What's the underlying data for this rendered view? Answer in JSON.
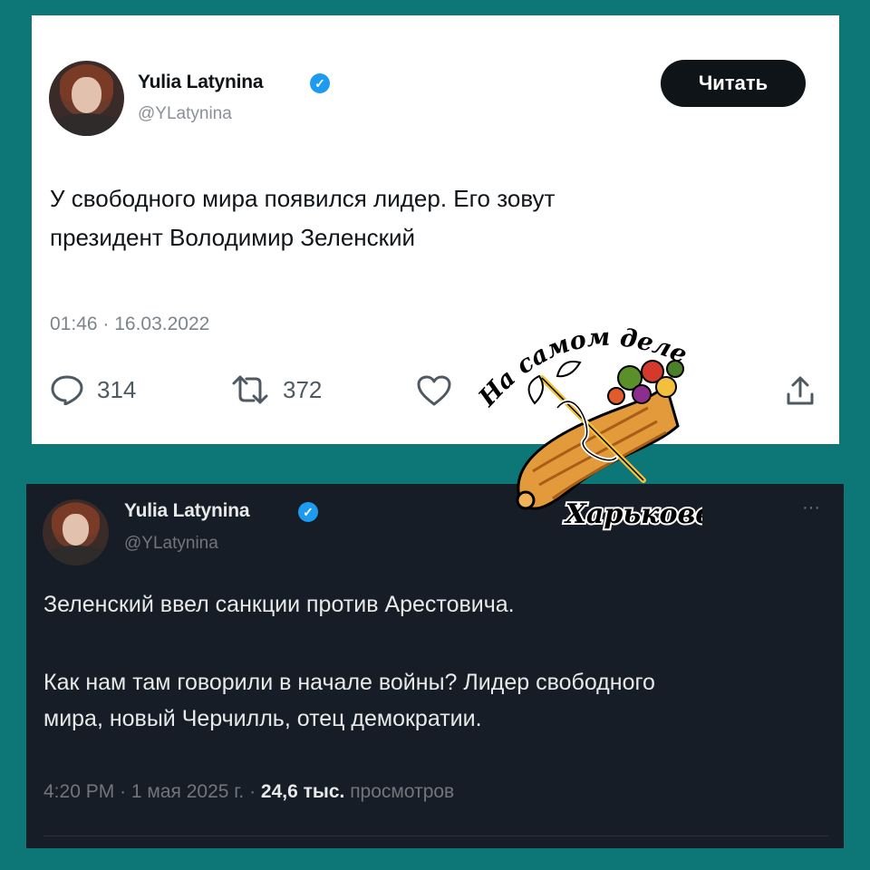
{
  "tweet1": {
    "name": "Yulia Latynina",
    "handle": "@YLatynina",
    "follow_button": "Читать",
    "text_line1": "У свободного мира появился лидер. Его зовут",
    "text_line2": "президент Володимир Зеленский",
    "timestamp": "01:46 · 16.03.2022",
    "replies": "314",
    "retweets": "372"
  },
  "tweet2": {
    "name": "Yulia Latynina",
    "handle": "@YLatynina",
    "more": "···",
    "paragraph1": "Зеленский ввел санкции против Арестовича.",
    "paragraph2_line1": "Как нам там говорили в начале войны? Лидер свободного",
    "paragraph2_line2": "мира, новый Черчилль, отец демократии.",
    "time": "4:20 PM",
    "date": "1 мая 2025 г.",
    "views": "24,6 тыс.",
    "views_label": "просмотров"
  },
  "logo": {
    "top_text": "На самом деле в",
    "bottom_text": "Харькове"
  },
  "colors": {
    "background": "#0d7676",
    "verified": "#1d9bf0",
    "dark_card": "#161d26"
  }
}
